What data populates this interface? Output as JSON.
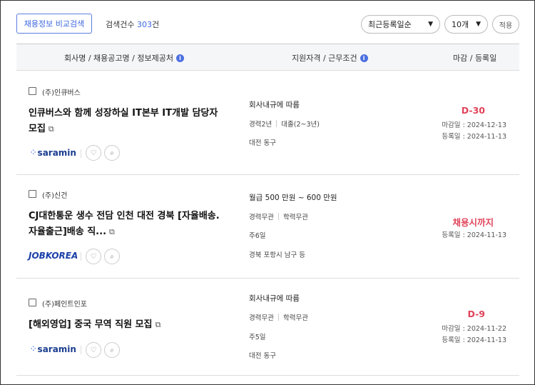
{
  "toolbar": {
    "compare_label": "채용정보 비교검색",
    "count_label": "검색건수",
    "count_value": "303",
    "count_unit": "건",
    "sort_value": "최근등록일순",
    "page_size_value": "10개",
    "apply_label": "적용"
  },
  "table_header": {
    "col1": "회사명 / 채용공고명 / 정보제공처",
    "col2": "지원자격 / 근무조건",
    "col3": "마감 / 등록일",
    "info_glyph": "i"
  },
  "rows": [
    {
      "company": "(주)인큐버스",
      "title": "인큐버스와 함께 성장하실 IT본부 IT개발 담당자 모집",
      "source": "saramin",
      "salary": "회사내규에 따름",
      "tag1": "경력2년",
      "tag2": "대졸(2~3년)",
      "line3": "대전 동구",
      "line4": "",
      "deadline": "D-30",
      "close_date": "마감일 : 2024-12-13",
      "reg_date": "등록일 : 2024-11-13"
    },
    {
      "company": "(주)신건",
      "title": "CJ대한통운 생수 전담 인천 대전 경북 [자율배송. 자율출근]배송 직...",
      "source": "JOBKOREA",
      "salary": "월급 500 만원 ~ 600 만원",
      "tag1": "경력무관",
      "tag2": "학력무관",
      "line3": "주6일",
      "line4": "경북 포항시 남구 등",
      "deadline": "채용시까지",
      "close_date": "",
      "reg_date": "등록일 : 2024-11-13"
    },
    {
      "company": "(주)페인트인포",
      "title": "[해외영업] 중국 무역 직원 모집",
      "source": "saramin",
      "salary": "회사내규에 따름",
      "tag1": "경력무관",
      "tag2": "학력무관",
      "line3": "주5일",
      "line4": "대전 동구",
      "deadline": "D-9",
      "close_date": "마감일 : 2024-11-22",
      "reg_date": "등록일 : 2024-11-13"
    }
  ],
  "icons": {
    "external": "⧉",
    "heart": "♡",
    "search": "⌕",
    "chevron": "⌄",
    "saramin_dots": "⁘"
  },
  "colors": {
    "accent": "#3d68e0",
    "deadline": "#e0435a",
    "info": "#4c6fe0"
  }
}
